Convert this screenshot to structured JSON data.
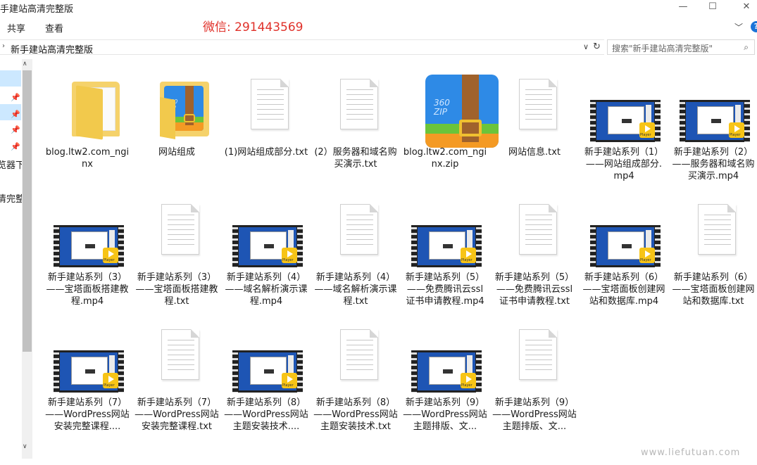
{
  "window": {
    "title": "手建站高清完整版",
    "minimize_glyph": "—",
    "maximize_glyph": "☐",
    "close_glyph": "✕"
  },
  "ribbon": {
    "tabs": [
      "共享",
      "查看"
    ],
    "wechat_text": "微信: 291443569"
  },
  "address": {
    "path": "新手建站高清完整版",
    "search_placeholder": "搜索\"新手建站高清完整版\""
  },
  "nav": {
    "partial_labels": [
      "览器下",
      "清完整"
    ]
  },
  "files": [
    {
      "type": "folder",
      "name": "blog.ltw2.com_nginx"
    },
    {
      "type": "folder-zip",
      "name": "网站组成"
    },
    {
      "type": "txt",
      "name": "(1)网站组成部分.txt"
    },
    {
      "type": "txt",
      "name": "(2）服务器和域名购买演示.txt"
    },
    {
      "type": "zip",
      "name": "blog.ltw2.com_nginx.zip"
    },
    {
      "type": "txt",
      "name": "网站信息.txt"
    },
    {
      "type": "video",
      "name": "新手建站系列（1）——网站组成部分.mp4"
    },
    {
      "type": "video",
      "name": "新手建站系列（2）——服务器和域名购买演示.mp4"
    },
    {
      "type": "video",
      "name": "新手建站系列（3）——宝塔面板搭建教程.mp4"
    },
    {
      "type": "txt",
      "name": "新手建站系列（3）——宝塔面板搭建教程.txt"
    },
    {
      "type": "video",
      "name": "新手建站系列（4）——域名解析演示课程.mp4"
    },
    {
      "type": "txt",
      "name": "新手建站系列（4）——域名解析演示课程.txt"
    },
    {
      "type": "video",
      "name": "新手建站系列（5）——免费腾讯云ssl证书申请教程.mp4"
    },
    {
      "type": "txt",
      "name": "新手建站系列（5）——免费腾讯云ssl证书申请教程.txt"
    },
    {
      "type": "video",
      "name": "新手建站系列（6）——宝塔面板创建网站和数据库.mp4"
    },
    {
      "type": "txt",
      "name": "新手建站系列（6）——宝塔面板创建网站和数据库.txt"
    },
    {
      "type": "video",
      "name": "新手建站系列（7）——WordPress网站安装完整课程...."
    },
    {
      "type": "txt",
      "name": "新手建站系列（7）——WordPress网站安装完整课程.txt"
    },
    {
      "type": "video",
      "name": "新手建站系列（8）——WordPress网站主题安装技术...."
    },
    {
      "type": "txt",
      "name": "新手建站系列（8）——WordPress网站主题安装技术.txt"
    },
    {
      "type": "video",
      "name": "新手建站系列（9）——WordPress网站主题排版、文..."
    },
    {
      "type": "txt",
      "name": "新手建站系列（9）——WordPress网站主题排版、文..."
    }
  ],
  "watermark": "www.liefutuan.com",
  "colors": {
    "wechat_red": "#e0312a",
    "selection_blue": "#cce8ff",
    "video_blue": "#1e55b4",
    "player_yellow": "#f7c416"
  }
}
